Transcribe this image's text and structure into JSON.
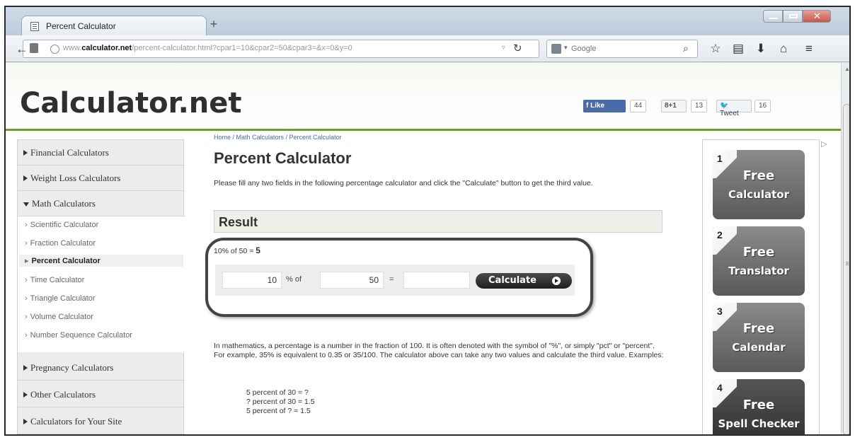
{
  "browser": {
    "tab_title": "Percent Calculator",
    "new_tab": "+",
    "url_prefix": "www.",
    "url_domain": "calculator.net",
    "url_path": "/percent-calculator.html?cpar1=10&cpar2=50&cpar3=&x=0&y=0",
    "search_placeholder": "Google",
    "icons": [
      "back-icon",
      "reload-icon",
      "search-icon",
      "bookmark-star-icon",
      "clipboard-icon",
      "download-icon",
      "home-icon",
      "menu-icon"
    ]
  },
  "site": {
    "logo": "Calculator.net",
    "social": {
      "like_label": "Like",
      "like_count": "44",
      "gplus_label": "8+1",
      "gplus_count": "13",
      "tweet_label": "Tweet",
      "tweet_count": "16"
    }
  },
  "sidebar": {
    "categories": [
      {
        "label": "Financial Calculators"
      },
      {
        "label": "Weight Loss Calculators"
      },
      {
        "label": "Math Calculators"
      },
      {
        "label": "Pregnancy Calculators"
      },
      {
        "label": "Other Calculators"
      },
      {
        "label": "Calculators for Your Site"
      }
    ],
    "math_items": [
      {
        "label": "Scientific Calculator"
      },
      {
        "label": "Fraction Calculator"
      },
      {
        "label": "Percent Calculator"
      },
      {
        "label": "Time Calculator"
      },
      {
        "label": "Triangle Calculator"
      },
      {
        "label": "Volume Calculator"
      },
      {
        "label": "Number Sequence Calculator"
      }
    ]
  },
  "main": {
    "breadcrumb": "Home / Math Calculators / Percent Calculator",
    "title": "Percent Calculator",
    "intro": "Please fill any two fields in the following percentage calculator and click the \"Calculate\" button to get the third value.",
    "result_heading": "Result",
    "result_text": "10% of 50 = ",
    "result_value": "5",
    "form": {
      "value1": "10",
      "label1": "% of",
      "value2": "50",
      "label2": "=",
      "value3": "",
      "button": "Calculate"
    },
    "explanation": "In mathematics, a percentage is a number in the fraction of 100. It is often denoted with the symbol of \"%\", or simply \"pct\" or \"percent\". For example, 35% is equivalent to 0.35 or 35/100. The calculator above can take any two values and calculate the third value. Examples:",
    "examples": [
      "5 percent of 30 = ?",
      "? percent of 30 = 1.5",
      "5 percent of ? = 1.5"
    ]
  },
  "ads": [
    {
      "num": "1",
      "free": "Free",
      "name": "Calculator"
    },
    {
      "num": "2",
      "free": "Free",
      "name": "Translator"
    },
    {
      "num": "3",
      "free": "Free",
      "name": "Calendar"
    },
    {
      "num": "4",
      "free": "Free",
      "name": "Spell Checker"
    }
  ]
}
